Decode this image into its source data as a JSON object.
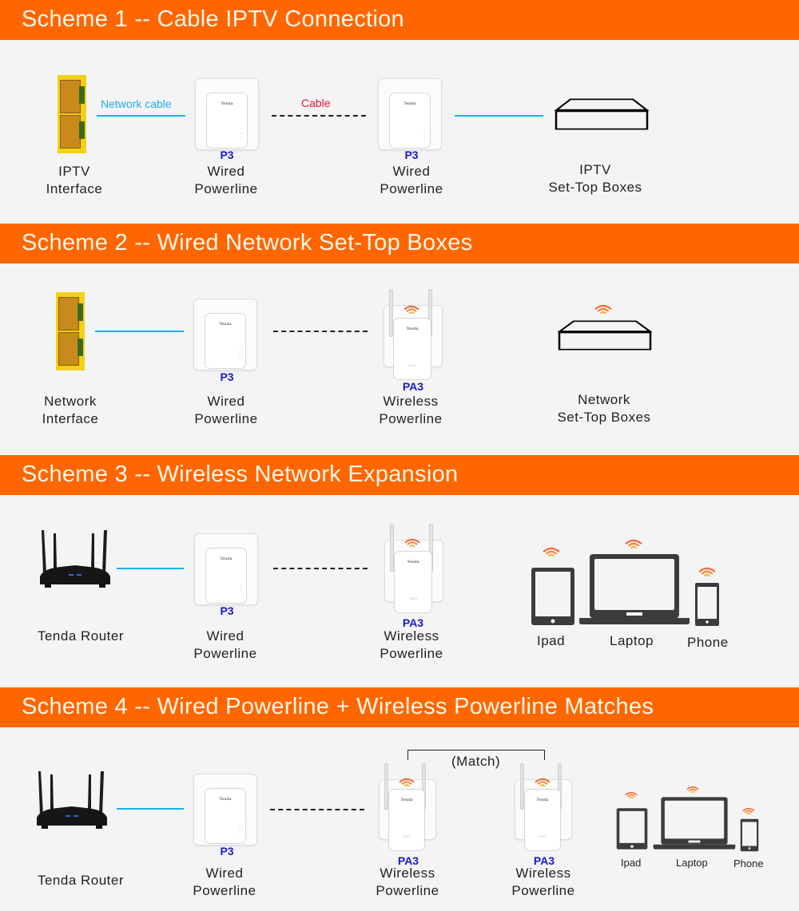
{
  "colors": {
    "band": "#ff6600",
    "band_text": "#fff7ea",
    "background": "#f4f4f4",
    "network_cable": "#1ab0e8",
    "model_label": "#1a1acc",
    "cable_label": "#e0183c",
    "network_cable_label": "#1ab0e8",
    "wifi_signal": "#f07838"
  },
  "schemes": [
    {
      "title": "Scheme 1 -- Cable IPTV Connection",
      "network_cable_label": "Network cable",
      "cable_label": "Cable",
      "nodes": [
        {
          "line1": "IPTV",
          "line2": "Interface"
        },
        {
          "model": "P3",
          "line1": "Wired",
          "line2": "Powerline"
        },
        {
          "model": "P3",
          "line1": "Wired",
          "line2": "Powerline"
        },
        {
          "line1": "IPTV",
          "line2": "Set-Top Boxes"
        }
      ]
    },
    {
      "title": "Scheme 2 -- Wired Network Set-Top Boxes",
      "nodes": [
        {
          "line1": "Network",
          "line2": "Interface"
        },
        {
          "model": "P3",
          "line1": "Wired",
          "line2": "Powerline"
        },
        {
          "model": "PA3",
          "line1": "Wireless",
          "line2": "Powerline"
        },
        {
          "line1": "Network",
          "line2": "Set-Top Boxes"
        }
      ]
    },
    {
      "title": "Scheme 3 -- Wireless Network Expansion",
      "nodes": [
        {
          "line1": "Tenda Router"
        },
        {
          "model": "P3",
          "line1": "Wired",
          "line2": "Powerline"
        },
        {
          "model": "PA3",
          "line1": "Wireless",
          "line2": "Powerline"
        }
      ],
      "devices": [
        "Ipad",
        "Laptop",
        "Phone"
      ]
    },
    {
      "title": "Scheme 4 -- Wired Powerline + Wireless Powerline Matches",
      "match_label": "(Match)",
      "nodes": [
        {
          "line1": "Tenda Router"
        },
        {
          "model": "P3",
          "line1": "Wired",
          "line2": "Powerline"
        },
        {
          "model": "PA3",
          "line1": "Wireless",
          "line2": "Powerline"
        },
        {
          "model": "PA3",
          "line1": "Wireless",
          "line2": "Powerline"
        }
      ],
      "devices": [
        "Ipad",
        "Laptop",
        "Phone"
      ]
    }
  ],
  "device_brand": "Tenda",
  "icons": {
    "interface": "ethernet-port-icon",
    "powerline": "powerline-adapter-icon",
    "wireless_powerline": "wireless-powerline-adapter-icon",
    "set_top_box": "set-top-box-icon",
    "router": "router-icon",
    "wifi": "wifi-signal-icon",
    "tablet": "tablet-icon",
    "laptop": "laptop-icon",
    "phone": "phone-icon"
  }
}
